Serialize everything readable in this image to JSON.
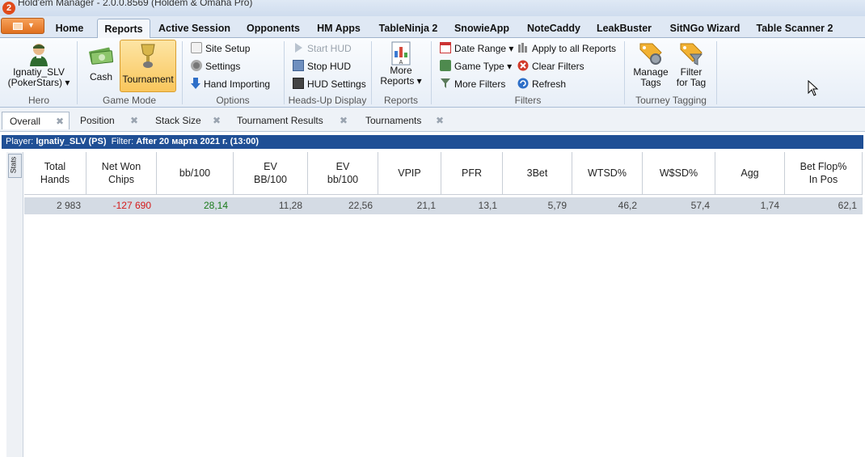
{
  "window": {
    "title": "Hold'em Manager - 2.0.0.8569 (Holdem & Omaha Pro)"
  },
  "ribbon_tabs": [
    "Home",
    "Reports",
    "Active Session",
    "Opponents",
    "HM Apps",
    "TableNinja 2",
    "SnowieApp",
    "NoteCaddy",
    "LeakBuster",
    "SitNGo Wizard",
    "Table Scanner 2"
  ],
  "active_ribbon_tab": "Reports",
  "hero": {
    "name_line1": "Ignatiy_SLV",
    "name_line2": "(PokerStars) ▾",
    "group": "Hero"
  },
  "game_mode": {
    "cash": "Cash",
    "tournament": "Tournament",
    "group": "Game Mode"
  },
  "options": {
    "site_setup": "Site Setup",
    "settings": "Settings",
    "hand_importing": "Hand Importing",
    "group": "Options"
  },
  "hud": {
    "start": "Start HUD",
    "stop": "Stop HUD",
    "settings": "HUD Settings",
    "group": "Heads-Up Display"
  },
  "reports": {
    "more_line1": "More",
    "more_line2": "Reports ▾",
    "group": "Reports"
  },
  "filters": {
    "date_range": "Date Range ▾",
    "game_type": "Game Type ▾",
    "more_filters": "More Filters",
    "apply_all": "Apply to all Reports",
    "clear": "Clear Filters",
    "refresh": "Refresh",
    "group": "Filters"
  },
  "tagging": {
    "manage_line1": "Manage",
    "manage_line2": "Tags",
    "filter_line1": "Filter",
    "filter_line2": "for Tag",
    "group": "Tourney Tagging"
  },
  "report_tabs": [
    "Overall",
    "Position",
    "Stack Size",
    "Tournament Results",
    "Tournaments"
  ],
  "filter_bar": {
    "player_label": "Player:",
    "player": "Ignatiy_SLV (PS)",
    "filter_label": "Filter:",
    "filter": "After 20 марта 2021 г. (13:00)"
  },
  "side_tab": "Stats",
  "table": {
    "headers": [
      [
        "Total",
        "Hands"
      ],
      [
        "Net Won",
        "Chips"
      ],
      [
        "bb/100",
        ""
      ],
      [
        "EV",
        "BB/100"
      ],
      [
        "EV",
        "bb/100"
      ],
      [
        "VPIP",
        ""
      ],
      [
        "PFR",
        ""
      ],
      [
        "3Bet",
        ""
      ],
      [
        "WTSD%",
        ""
      ],
      [
        "W$SD%",
        ""
      ],
      [
        "Agg",
        ""
      ],
      [
        "Bet Flop%",
        "In Pos"
      ]
    ],
    "row": [
      "2 983",
      "-127 690",
      "28,14",
      "11,28",
      "22,56",
      "21,1",
      "13,1",
      "5,79",
      "46,2",
      "57,4",
      "1,74",
      "62,1"
    ]
  },
  "colors": {
    "filter_bar": "#1f4f95",
    "negative": "#d41a1a",
    "positive": "#1a7a1a",
    "selected_button": "#f9c65c"
  }
}
